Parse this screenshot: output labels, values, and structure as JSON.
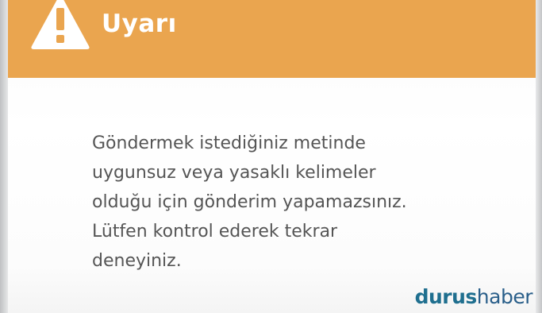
{
  "dialog": {
    "title": "Uyarı",
    "icon": "warning-icon",
    "message_lines": [
      "Göndermek istediğiniz metinde",
      "uygunsuz veya yasaklı kelimeler",
      "olduğu için gönderim yapamazsınız.",
      "Lütfen kontrol ederek tekrar",
      "deneyiniz."
    ]
  },
  "watermark": {
    "part_a": "durus",
    "part_b": "haber"
  },
  "colors": {
    "header": "#eaa54f",
    "header_text": "#ffffff",
    "body_text": "#555555",
    "watermark": "#1f6f8f"
  }
}
